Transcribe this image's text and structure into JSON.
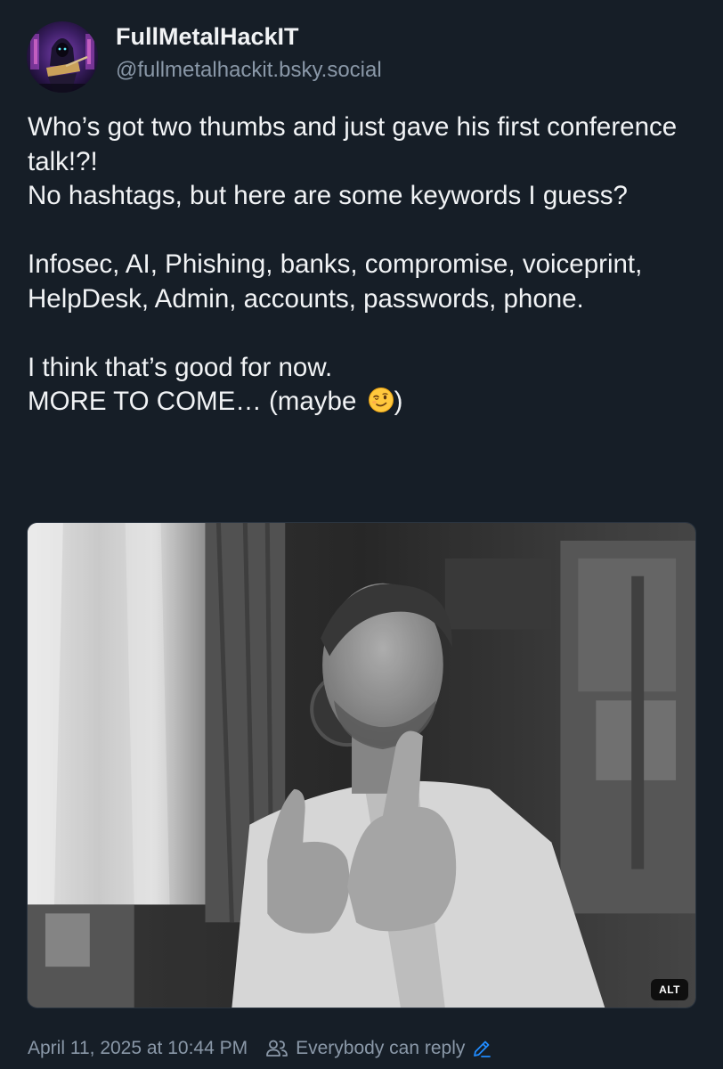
{
  "author": {
    "display_name": "FullMetalHackIT",
    "handle": "@fullmetalhackit.bsky.social",
    "avatar_icon": "avatar-hacker-guitarist"
  },
  "post": {
    "text": "Who’s got two thumbs and just gave his first conference talk!?!\nNo hashtags, but here are some keywords I guess?\n\nInfosec, AI, Phishing, banks, compromise, voiceprint, HelpDesk, Admin, accounts, passwords, phone.\n\nI think that’s good for now.\nMORE TO COME… (maybe ",
    "emoji_icon": "winking-face-emoji",
    "text_end": ")"
  },
  "media": {
    "alt_badge": "ALT"
  },
  "footer": {
    "timestamp": "April 11, 2025 at 10:44 PM",
    "reply_setting": "Everybody can reply",
    "people_icon": "people-icon",
    "edit_icon": "pencil-icon"
  },
  "colors": {
    "background": "#161e27",
    "text_primary": "#f1f3f5",
    "text_secondary": "#8a98a8",
    "accent": "#208bfe"
  }
}
